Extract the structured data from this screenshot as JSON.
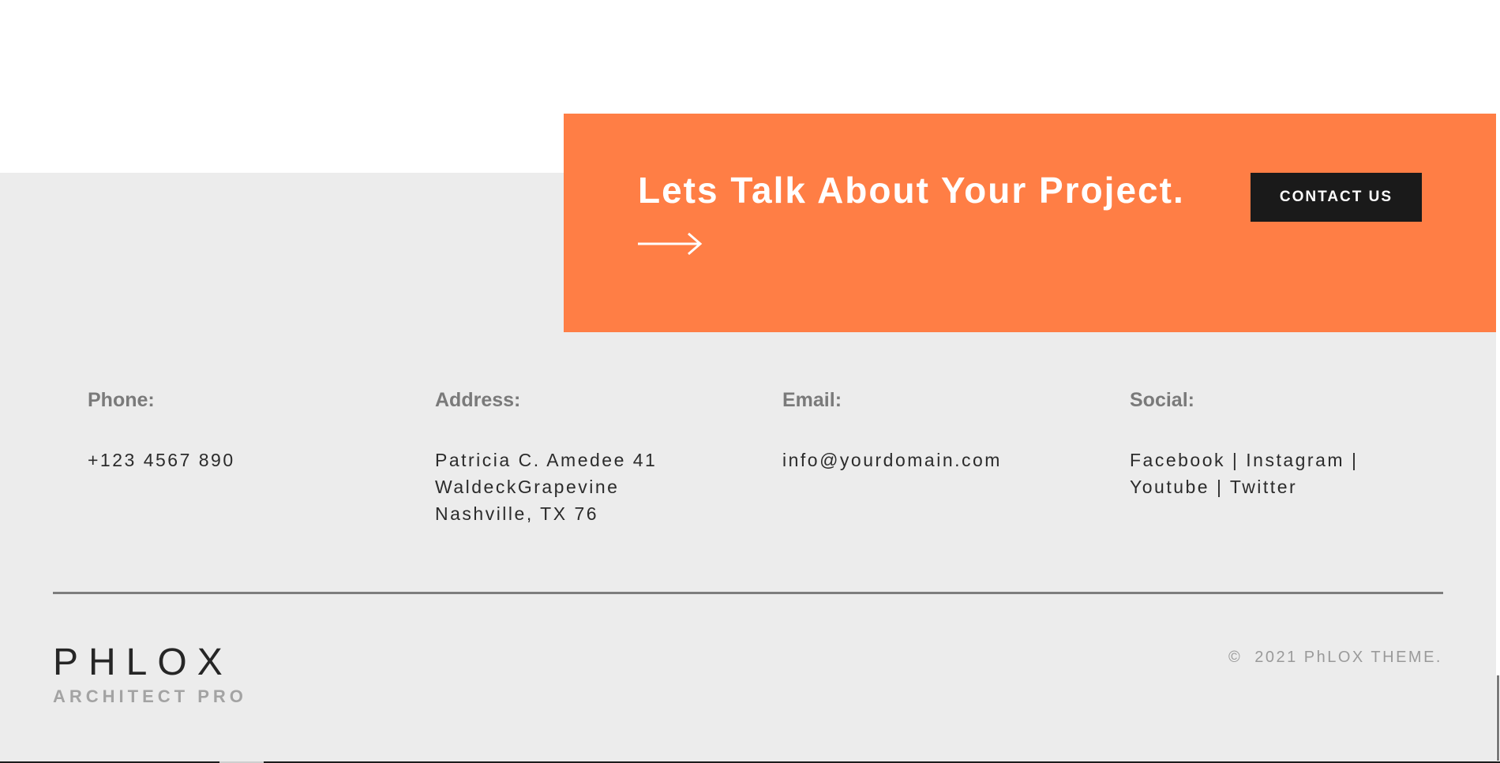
{
  "cta": {
    "title": "Lets Talk About Your Project.",
    "arrow_icon": "long-arrow-right-icon",
    "button_label": "CONTACT US",
    "background_color": "#ff7e45"
  },
  "info": {
    "phone": {
      "label": "Phone:",
      "lines": [
        "+123 4567 890"
      ]
    },
    "address": {
      "label": "Address:",
      "lines": [
        "Patricia C. Amedee 41",
        "WaldeckGrapevine",
        "Nashville, TX 76"
      ]
    },
    "email": {
      "label": "Email:",
      "lines": [
        "info@yourdomain.com"
      ]
    },
    "social": {
      "label": "Social:",
      "links": [
        "Facebook",
        "Instagram",
        "Youtube",
        "Twitter"
      ],
      "separator": "|"
    }
  },
  "footer": {
    "logo_mark": "PHLOX",
    "logo_sub": "ARCHITECT PRO",
    "copyright_symbol": "©",
    "copyright_text": "2021 PhLOX THEME."
  }
}
